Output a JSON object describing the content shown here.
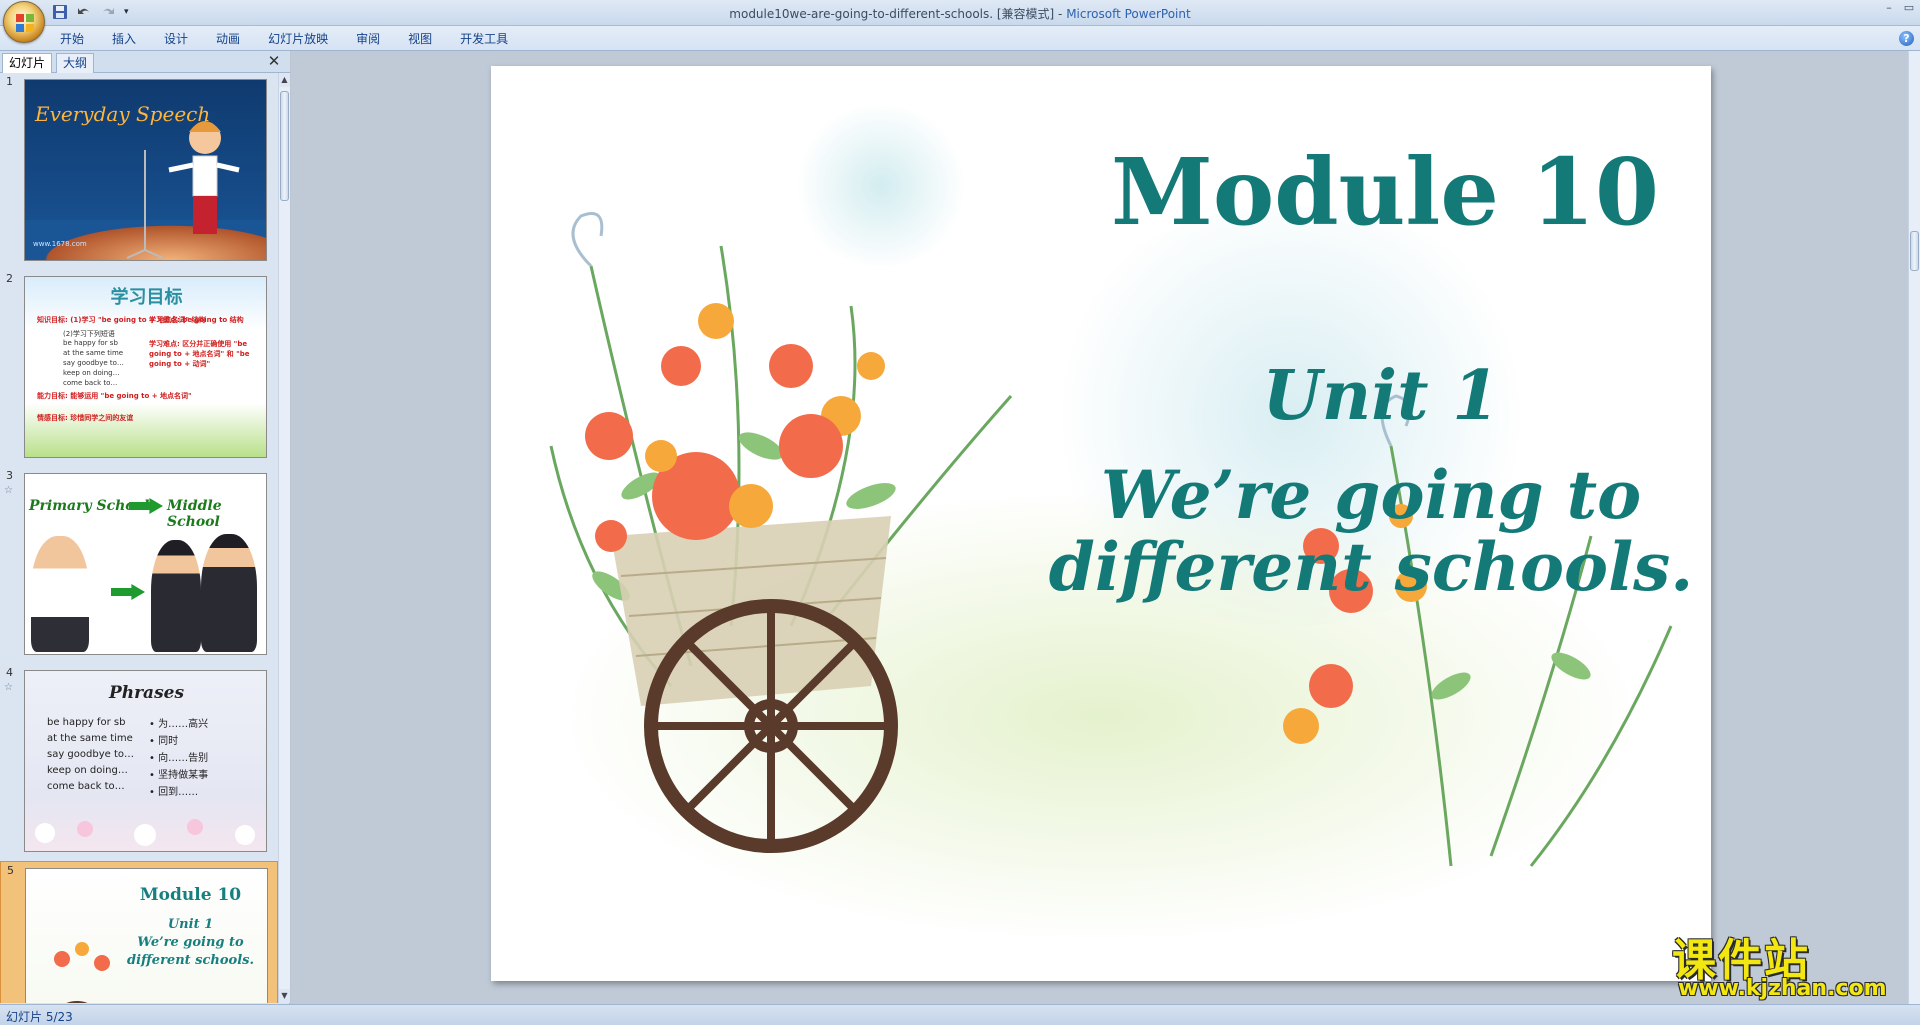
{
  "window": {
    "title_doc": "module10we-are-going-to-different-schools. [兼容模式] - ",
    "title_app": "Microsoft PowerPoint"
  },
  "ribbon": {
    "tabs": [
      "开始",
      "插入",
      "设计",
      "动画",
      "幻灯片放映",
      "审阅",
      "视图",
      "开发工具"
    ]
  },
  "panel": {
    "tab_slides": "幻灯片",
    "tab_outline": "大纲",
    "thumbnails": [
      {
        "num": "1",
        "title": "Everyday Speech",
        "watermark": "www.1678.com"
      },
      {
        "num": "2",
        "title": "学习目标",
        "lines": [
          "知识目标: (1)学习 \"be going to + 地点名词\" 结构",
          "(2)学习下列短语",
          "be happy for sb",
          "at the same time",
          "say goodbye to…",
          "keep on doing…",
          "come back to…",
          "能力目标: 能够运用 \"be going to + 地点名词\"",
          "情感目标: 珍惜同学之间的友谊"
        ],
        "focus": "学习重点: be going to 结构",
        "difficulty": "学习难点: 区分并正确使用 \"be going to + 地点名词\" 和 \"be going to + 动词\""
      },
      {
        "num": "3",
        "from": "Primary School",
        "to": "Middle School"
      },
      {
        "num": "4",
        "title": "Phrases",
        "phrases_en": [
          "be happy for sb",
          "at the same time",
          "say goodbye to…",
          "keep on doing…",
          "come back to…"
        ],
        "phrases_cn": [
          "• 为……高兴",
          "• 同时",
          "• 向……告别",
          "• 坚持做某事",
          "• 回到……"
        ]
      },
      {
        "num": "5",
        "title": "Module 10",
        "unit": "Unit 1",
        "sub1": "We’re going to",
        "sub2": "different schools."
      }
    ]
  },
  "slide": {
    "title": "Module 10",
    "unit": "Unit 1",
    "subtitle_line1": "We’re going to",
    "subtitle_line2": "different schools."
  },
  "status": {
    "slide_counter": "幻灯片 5/23"
  },
  "watermark": {
    "cn": "课件站",
    "url": "www.kjzhan.com"
  },
  "colors": {
    "accent_teal": "#137a78",
    "ribbon_text": "#15428b",
    "watermark_yellow": "#f3e711"
  }
}
